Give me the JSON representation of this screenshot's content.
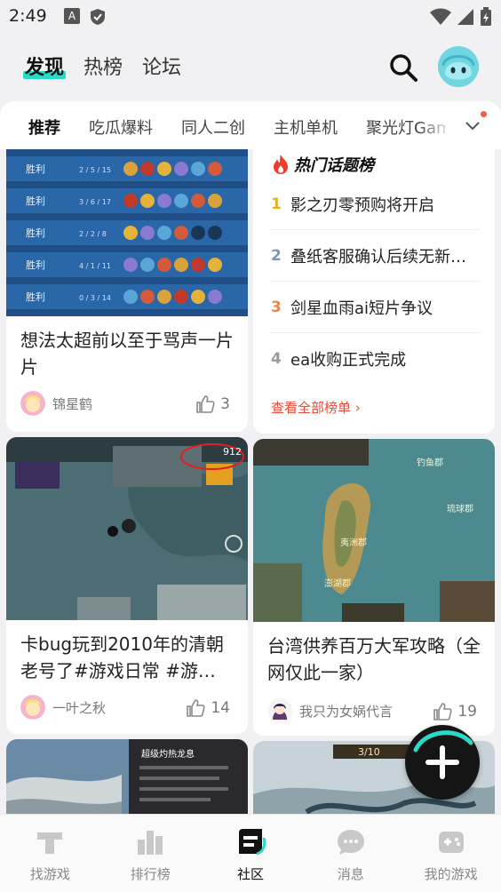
{
  "status_bar": {
    "time": "2:49",
    "a_icon_letter": "A"
  },
  "header": {
    "tabs": [
      {
        "label": "发现",
        "active": true
      },
      {
        "label": "热榜",
        "active": false
      },
      {
        "label": "论坛",
        "active": false
      }
    ],
    "icons": [
      "search-icon",
      "user-avatar"
    ]
  },
  "sub_tabs": [
    "推荐",
    "吃瓜爆料",
    "同人二创",
    "主机单机",
    "聚光灯Game"
  ],
  "hot_topics": {
    "title": "热门话题榜",
    "items": [
      {
        "rank": "1",
        "text": "影之刃零预购将开启",
        "color": "#e6b422"
      },
      {
        "rank": "2",
        "text": "叠纸客服确认后续无新增氪金池",
        "color": "#7f97b2"
      },
      {
        "rank": "3",
        "text": "剑星血雨ai短片争议",
        "color": "#e8894a"
      },
      {
        "rank": "4",
        "text": "ea收购正式完成",
        "color": "#9a9a9a"
      }
    ],
    "more_label": "查看全部榜单 ›"
  },
  "cards": [
    {
      "title": "想法太超前以至于骂声一片片",
      "author": "锦星鹤",
      "likes": "3",
      "victory_label": "胜利",
      "row_stats": [
        "2 / 5 / 15",
        "3 / 6 / 17",
        "2 / 2 / 8",
        "4 / 1 / 11",
        "0 / 3 / 14"
      ]
    },
    {
      "title": "卡bug玩到2010年的清朝老号了#游戏日常 #游…",
      "author": "一叶之秋",
      "likes": "14",
      "hud_value": "912"
    },
    {
      "title": "台湾供养百万大军攻略（全网仅此一家）",
      "author": "我只为女娲代言",
      "likes": "19",
      "map_labels": [
        "夷洲郡",
        "钓鱼郡",
        "琉球郡",
        "澎湖郡"
      ]
    },
    {
      "title": "",
      "author": "",
      "likes": "",
      "overlay_title": "超级灼热龙息"
    },
    {
      "title": "",
      "author": "",
      "likes": "",
      "counter": "3/10"
    }
  ],
  "bottom_nav": [
    {
      "label": "找游戏",
      "icon": "game-controller-icon",
      "active": false
    },
    {
      "label": "排行榜",
      "icon": "ranking-icon",
      "active": false
    },
    {
      "label": "社区",
      "icon": "community-icon",
      "active": true
    },
    {
      "label": "消息",
      "icon": "message-icon",
      "active": false
    },
    {
      "label": "我的游戏",
      "icon": "my-games-icon",
      "active": false
    }
  ],
  "colors": {
    "accent": "#2bd9c8",
    "hot_red": "#ee4a38"
  }
}
